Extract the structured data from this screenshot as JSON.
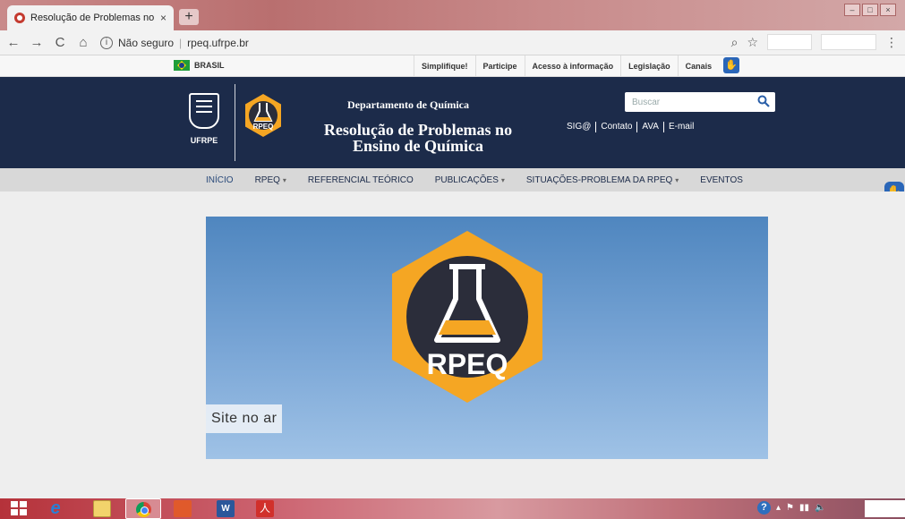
{
  "browser": {
    "tab_title": "Resolução de Problemas no Ensi",
    "tab_close": "×",
    "new_tab": "+",
    "security_label": "Não seguro",
    "url": "rpeq.ufrpe.br",
    "back": "←",
    "forward": "→",
    "reload": "C",
    "home": "⌂",
    "info": "i",
    "zoom": "⌕",
    "bookmark": "☆",
    "menu": "⋮"
  },
  "gov_bar": {
    "country": "BRASIL",
    "links": [
      "Simplifique!",
      "Participe",
      "Acesso à informação",
      "Legislação",
      "Canais"
    ]
  },
  "header": {
    "university": "UFRPE",
    "logo_text": "RPEQ",
    "department": "Departamento de Química",
    "site_title": "Resolução de Problemas no Ensino de Química",
    "search_placeholder": "Buscar",
    "top_links": [
      "SIG@",
      "Contato",
      "AVA",
      "E-mail"
    ]
  },
  "nav": {
    "items": [
      {
        "label": "INÍCIO",
        "caret": ""
      },
      {
        "label": "RPEQ",
        "caret": "▾"
      },
      {
        "label": "REFERENCIAL TEÓRICO",
        "caret": ""
      },
      {
        "label": "PUBLICAÇÕES",
        "caret": "▾"
      },
      {
        "label": "SITUAÇÕES-PROBLEMA DA RPEQ",
        "caret": "▾"
      },
      {
        "label": "EVENTOS",
        "caret": ""
      }
    ]
  },
  "banner": {
    "logo_text": "RPEQ",
    "caption": "Site no ar"
  },
  "taskbar": {
    "word_label": "W",
    "pdf_label": "人",
    "help_label": "?"
  },
  "colors": {
    "header_bg": "#1c2b4a",
    "menu_bg": "#d8d8d8",
    "hex_orange": "#f5a623",
    "circle_dark": "#2b2d3a",
    "banner_blue": "#4f86bf"
  }
}
